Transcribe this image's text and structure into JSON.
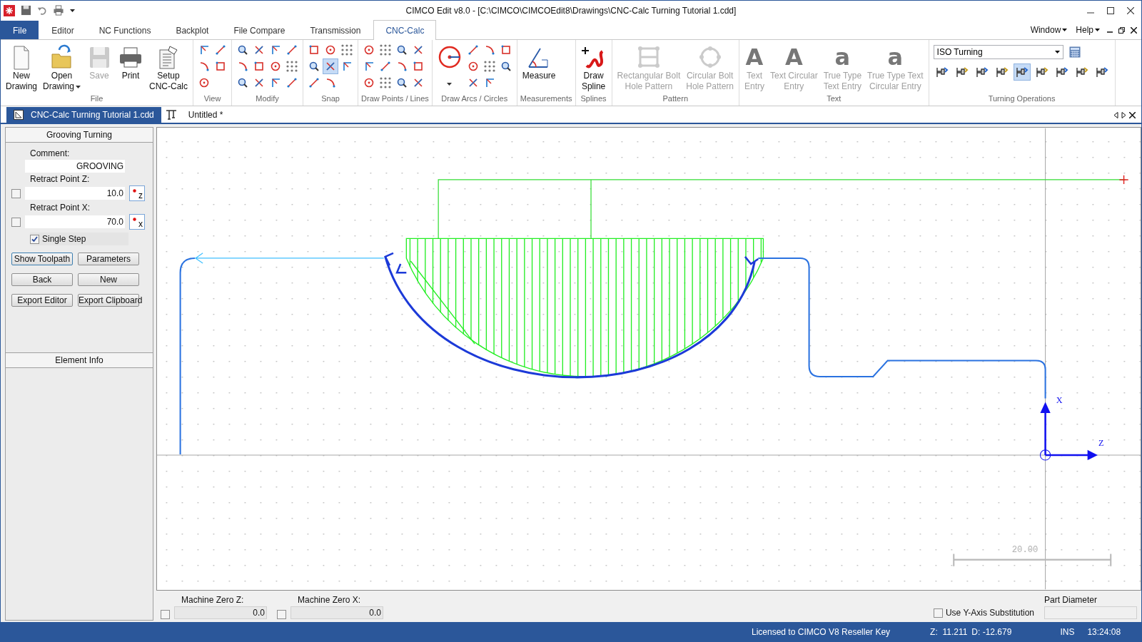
{
  "window": {
    "title": "CIMCO Edit v8.0 - [C:\\CIMCO\\CIMCOEdit8\\Drawings\\CNC-Calc Turning Tutorial 1.cdd]"
  },
  "ribbon_tabs": [
    {
      "label": "File",
      "kind": "file",
      "selected": false
    },
    {
      "label": "Editor",
      "kind": "tab",
      "selected": false
    },
    {
      "label": "NC Functions",
      "kind": "tab",
      "selected": false
    },
    {
      "label": "Backplot",
      "kind": "tab",
      "selected": false
    },
    {
      "label": "File Compare",
      "kind": "tab",
      "selected": false
    },
    {
      "label": "Transmission",
      "kind": "tab",
      "selected": false
    },
    {
      "label": "CNC-Calc",
      "kind": "tab",
      "selected": true
    }
  ],
  "menu_right": [
    {
      "label": "Window"
    },
    {
      "label": "Help"
    }
  ],
  "ribbon_groups": [
    {
      "label": "File",
      "items": [
        {
          "kind": "button",
          "lines": [
            "New",
            "Drawing"
          ],
          "disabled": false
        },
        {
          "kind": "button",
          "lines": [
            "Open",
            "Drawing"
          ],
          "disabled": false,
          "dropdown": true
        },
        {
          "kind": "button",
          "lines": [
            "Save"
          ],
          "disabled": true
        },
        {
          "kind": "button",
          "lines": [
            "Print"
          ],
          "disabled": false
        },
        {
          "kind": "button",
          "lines": [
            "Setup",
            "CNC-Calc"
          ],
          "disabled": false
        }
      ]
    },
    {
      "label": "View",
      "items": [
        {
          "kind": "icons",
          "icons": [
            {
              "selected": false
            },
            {
              "selected": false
            },
            {
              "selected": false
            },
            {
              "selected": false
            },
            {
              "selected": false
            }
          ]
        }
      ]
    },
    {
      "label": "Modify",
      "items": [
        {
          "kind": "icons",
          "icons": [
            {
              "selected": false
            },
            {
              "selected": false
            },
            {
              "selected": false
            },
            {
              "selected": false
            },
            {
              "selected": false
            },
            {
              "selected": false
            },
            {
              "selected": false
            },
            {
              "selected": false
            },
            {
              "selected": false
            },
            {
              "selected": false
            },
            {
              "selected": false
            },
            {
              "selected": false
            }
          ]
        }
      ]
    },
    {
      "label": "Snap",
      "items": [
        {
          "kind": "icons",
          "icons": [
            {
              "selected": false
            },
            {
              "selected": false
            },
            {
              "selected": false
            },
            {
              "selected": false
            },
            {
              "selected": true
            },
            {
              "selected": false
            },
            {
              "selected": false
            },
            {
              "selected": false
            }
          ]
        }
      ]
    },
    {
      "label": "Draw Points / Lines",
      "items": [
        {
          "kind": "icons",
          "icons": [
            {
              "selected": false
            },
            {
              "selected": false
            },
            {
              "selected": false
            },
            {
              "selected": false
            },
            {
              "selected": false
            },
            {
              "selected": false
            },
            {
              "selected": false
            },
            {
              "selected": false
            },
            {
              "selected": false
            },
            {
              "selected": false
            },
            {
              "selected": false
            },
            {
              "selected": false
            }
          ]
        }
      ]
    },
    {
      "label": "Draw Arcs / Circles",
      "items": [
        {
          "kind": "big_icon"
        },
        {
          "kind": "icons",
          "icons": [
            {
              "selected": false
            },
            {
              "selected": false
            },
            {
              "selected": false
            },
            {
              "selected": false
            },
            {
              "selected": false
            },
            {
              "selected": false
            },
            {
              "selected": false
            },
            {
              "selected": false
            }
          ]
        }
      ]
    },
    {
      "label": "Measurements",
      "items": [
        {
          "kind": "button",
          "lines": [
            "Measure"
          ],
          "disabled": false
        }
      ]
    },
    {
      "label": "Splines",
      "items": [
        {
          "kind": "button",
          "lines": [
            "Draw",
            "Spline"
          ],
          "disabled": false
        }
      ]
    },
    {
      "label": "Pattern",
      "items": [
        {
          "kind": "button",
          "lines": [
            "Rectangular Bolt",
            "Hole Pattern"
          ],
          "disabled": true
        },
        {
          "kind": "button",
          "lines": [
            "Circular Bolt",
            "Hole Pattern"
          ],
          "disabled": true
        }
      ]
    },
    {
      "label": "Text",
      "items": [
        {
          "kind": "button",
          "glyph": "A",
          "lines": [
            "Text",
            "Entry"
          ],
          "disabled": true
        },
        {
          "kind": "button",
          "glyph": "A",
          "lines": [
            "Text Circular",
            "Entry"
          ],
          "disabled": true
        },
        {
          "kind": "button",
          "glyph": "a",
          "lines": [
            "True Type",
            "Text Entry"
          ],
          "disabled": true
        },
        {
          "kind": "button",
          "glyph": "a",
          "lines": [
            "True Type Text",
            "Circular Entry"
          ],
          "disabled": true
        }
      ]
    },
    {
      "label": "Turning Operations",
      "items": [
        {
          "kind": "combo",
          "value": "ISO Turning",
          "icons": [
            {
              "selected": false
            },
            {
              "selected": false
            },
            {
              "selected": false
            },
            {
              "selected": false
            },
            {
              "selected": true
            },
            {
              "selected": false
            },
            {
              "selected": false
            },
            {
              "selected": false
            },
            {
              "selected": false
            }
          ]
        }
      ]
    }
  ],
  "document_tabs": [
    {
      "label": "CNC-Calc Turning Tutorial 1.cdd",
      "selected": true
    },
    {
      "label": "Untitled *",
      "selected": false
    }
  ],
  "panel": {
    "title": "Grooving Turning",
    "fields": [
      {
        "kind": "text",
        "label": "Comment:",
        "value": "GROOVING"
      },
      {
        "kind": "pick",
        "label": "Retract Point Z:",
        "value": "10.0",
        "checked": false,
        "pick": "z"
      },
      {
        "kind": "pick",
        "label": "Retract Point X:",
        "value": "70.0",
        "checked": false,
        "pick": "x"
      }
    ],
    "single_step": {
      "label": "Single Step",
      "checked": true
    },
    "buttons": [
      {
        "label": "Show Toolpath",
        "focused": true
      },
      {
        "label": "Parameters",
        "focused": false
      },
      {
        "label": "Back",
        "focused": false
      },
      {
        "label": "New",
        "focused": false
      },
      {
        "label": "Export Editor",
        "focused": false
      },
      {
        "label": "Export Clipboard",
        "focused": false
      }
    ],
    "section": "Element Info"
  },
  "canvas": {
    "x_label": "X",
    "z_label": "Z",
    "scale_label": "20.00"
  },
  "bottom": {
    "fields": [
      {
        "label": "Machine Zero Z:",
        "value": "0.0",
        "checked": false
      },
      {
        "label": "Machine Zero X:",
        "value": "0.0",
        "checked": false
      }
    ],
    "substitution": {
      "label": "Use Y-Axis Substitution",
      "checked": false
    },
    "diameter": {
      "label": "Part Diameter"
    }
  },
  "status_bar": {
    "license": "Licensed to CIMCO V8 Reseller Key",
    "z": "Z:  11.211",
    "d": "D: -12.679",
    "mode": "INS",
    "time": "13:24:08"
  }
}
